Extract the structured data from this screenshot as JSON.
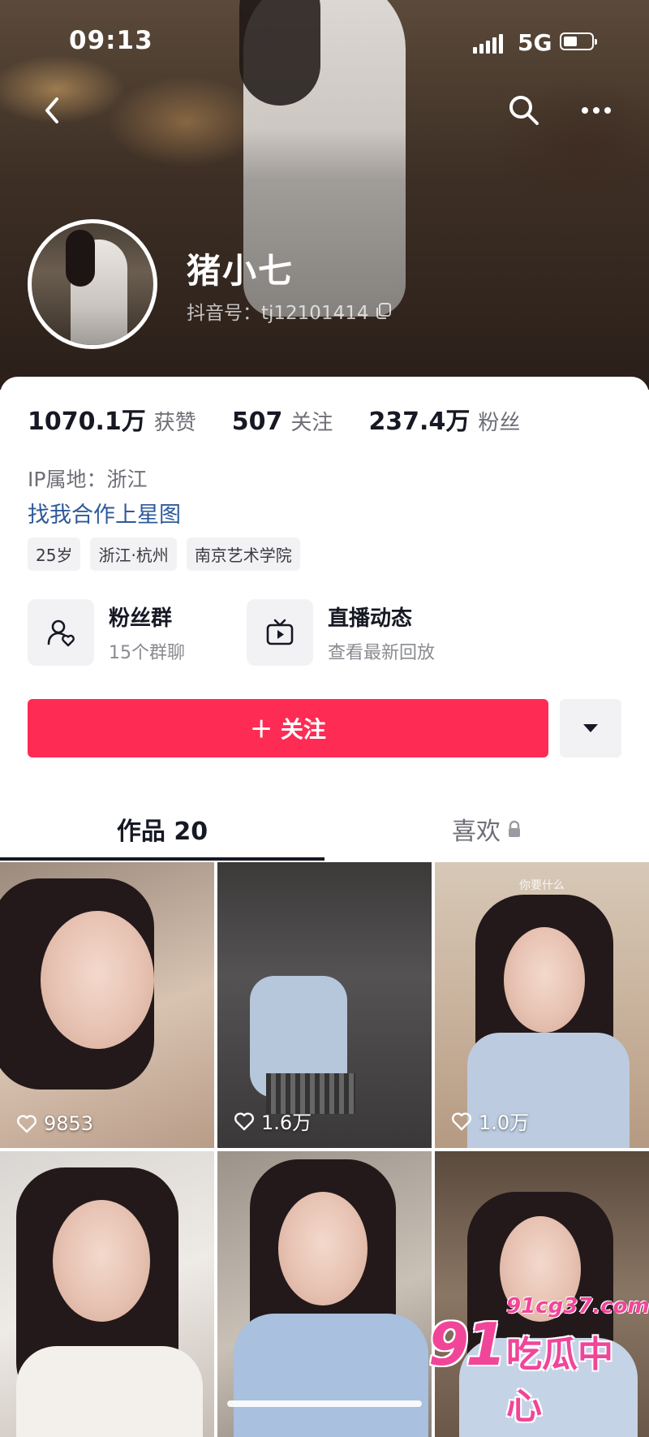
{
  "status_bar": {
    "time": "09:13",
    "network": "5G"
  },
  "profile": {
    "name": "猪小七",
    "douyin_id": "抖音号：tj12101414",
    "stats": [
      {
        "value": "1070.1万",
        "label": "获赞"
      },
      {
        "value": "507",
        "label": "关注"
      },
      {
        "value": "237.4万",
        "label": "粉丝"
      }
    ],
    "ip_location": "IP属地：浙江",
    "star_link": "找我合作上星图",
    "tags": [
      "25岁",
      "浙江·杭州",
      "南京艺术学院"
    ]
  },
  "entries": [
    {
      "title": "粉丝群",
      "subtitle": "15个群聊",
      "icon": "fan-group-icon"
    },
    {
      "title": "直播动态",
      "subtitle": "查看最新回放",
      "icon": "tv-icon"
    }
  ],
  "actions": {
    "follow_label": "＋ 关注"
  },
  "tabs": {
    "works": "作品 20",
    "likes": "喜欢"
  },
  "videos": [
    {
      "likes": "9853"
    },
    {
      "likes": "1.6万"
    },
    {
      "likes": "1.0万",
      "caption": "你要什么"
    },
    {
      "likes": ""
    },
    {
      "likes": ""
    },
    {
      "likes": ""
    }
  ],
  "watermark": {
    "num": "91",
    "site": "91cg37.com",
    "name": "吃瓜中心"
  },
  "colors": {
    "accent": "#fe2c55",
    "link": "#2e5a9b"
  }
}
